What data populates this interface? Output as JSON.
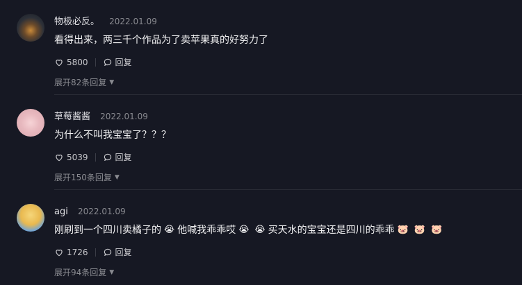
{
  "comments": [
    {
      "user": "物极必反。",
      "date": "2022.01.09",
      "text": "看得出来，两三千个作品为了卖苹果真的好努力了",
      "likes": "5800",
      "reply_label": "回复",
      "expand_label": "展开82条回复"
    },
    {
      "user": "草莓酱酱",
      "date": "2022.01.09",
      "text": "为什么不叫我宝宝了？？？",
      "likes": "5039",
      "reply_label": "回复",
      "expand_label": "展开150条回复"
    },
    {
      "user": "agi",
      "date": "2022.01.09",
      "text_parts": [
        "刚刷到一个四川卖橘子的",
        "他喊我乖乖哎",
        "买天水的宝宝还是四川的乖乖"
      ],
      "likes": "1726",
      "reply_label": "回复",
      "expand_label": "展开94条回复"
    }
  ],
  "icons": {
    "like": "heart-outline-icon",
    "reply": "speech-bubble-icon",
    "expand": "caret-down-icon",
    "emoji_cry": "loudly-crying-face",
    "emoji_pig": "pig-face"
  }
}
